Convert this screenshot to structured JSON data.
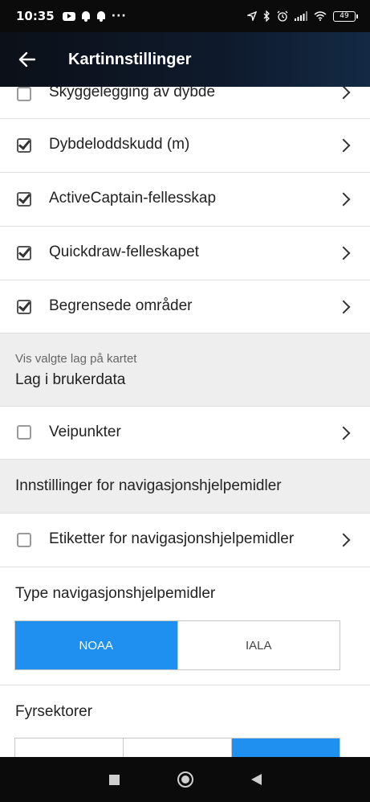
{
  "status_bar": {
    "time": "10:35",
    "overflow": "···",
    "battery": "49"
  },
  "app_bar": {
    "title": "Kartinnstillinger",
    "back_icon": "arrow-left-icon"
  },
  "rows_top": [
    {
      "label": "Skyggelegging av dybde",
      "checked": false
    },
    {
      "label": "Dybdeloddskudd (m)",
      "checked": true
    },
    {
      "label": "ActiveCaptain-fellesskap",
      "checked": true
    },
    {
      "label": "Quickdraw-felleskapet",
      "checked": true
    },
    {
      "label": "Begrensede områder",
      "checked": true
    }
  ],
  "user_data_section": {
    "caption": "Vis valgte lag på kartet",
    "heading": "Lag i brukerdata"
  },
  "waypoints_row": {
    "label": "Veipunkter",
    "checked": false
  },
  "nav_aids_section": {
    "heading": "Innstillinger for navigasjonshjelpemidler"
  },
  "labels_row": {
    "label": "Etiketter for navigasjonshjelpemidler",
    "checked": false
  },
  "nav_aid_type": {
    "title": "Type navigasjonshjelpemidler",
    "options": [
      "NOAA",
      "IALA"
    ],
    "selected": "NOAA"
  },
  "light_sectors": {
    "title": "Fyrsektorer"
  },
  "colors": {
    "accent": "#1f8ff0",
    "appbar": "#0e1a2c",
    "section_bg": "#eeeeee"
  }
}
